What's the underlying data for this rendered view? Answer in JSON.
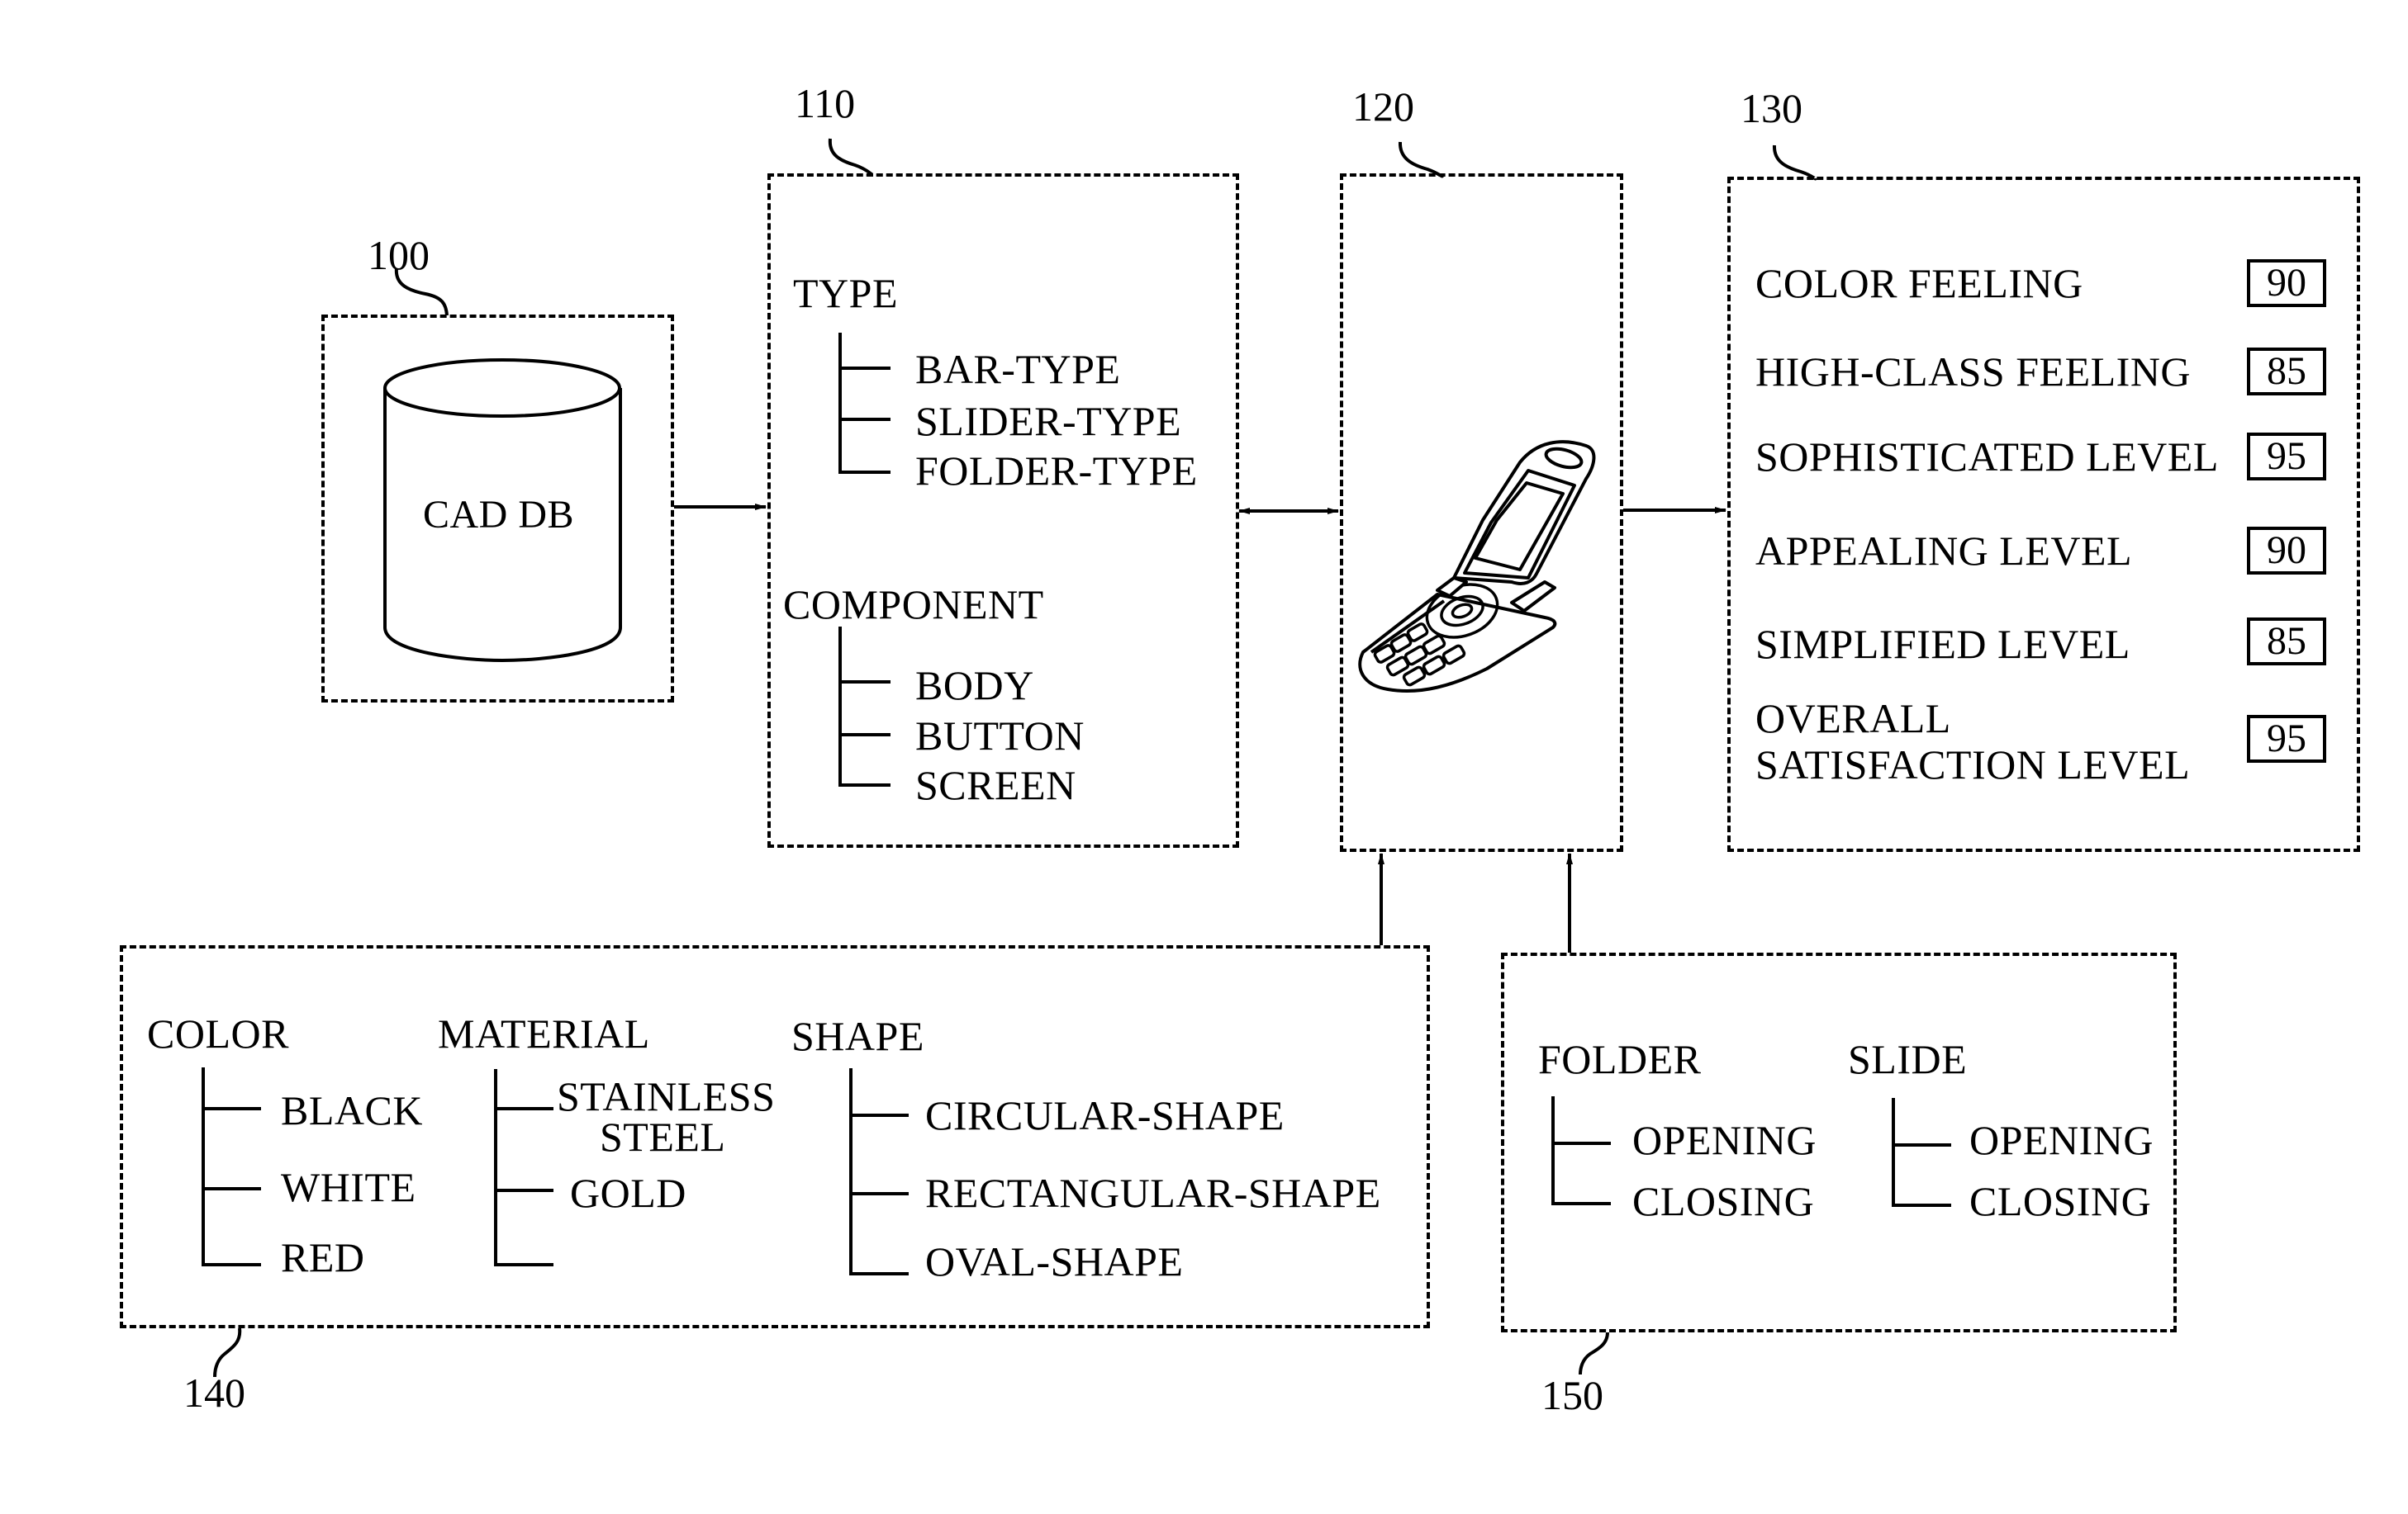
{
  "figure": {
    "cad_db": {
      "ref": "100",
      "label": "CAD DB"
    },
    "design_options": {
      "ref": "110",
      "groups": [
        {
          "title": "TYPE",
          "items": [
            "BAR-TYPE",
            "SLIDER-TYPE",
            "FOLDER-TYPE"
          ]
        },
        {
          "title": "COMPONENT",
          "items": [
            "BODY",
            "BUTTON",
            "SCREEN"
          ]
        }
      ]
    },
    "product_model": {
      "ref": "120",
      "icon": "flip-phone-icon"
    },
    "evaluation": {
      "ref": "130",
      "criteria": [
        {
          "label": "COLOR FEELING",
          "score": "90"
        },
        {
          "label": "HIGH-CLASS FEELING",
          "score": "85"
        },
        {
          "label": "SOPHISTICATED LEVEL",
          "score": "95"
        },
        {
          "label": "APPEALING LEVEL",
          "score": "90"
        },
        {
          "label": "SIMPLIFIED LEVEL",
          "score": "85"
        },
        {
          "label_line1": "OVERALL",
          "label_line2": "SATISFACTION LEVEL",
          "score": "95"
        }
      ]
    },
    "attributes": {
      "ref": "140",
      "groups": [
        {
          "title": "COLOR",
          "items": [
            "BLACK",
            "WHITE",
            "RED"
          ]
        },
        {
          "title": "MATERIAL",
          "items": [
            "STAINLESS STEEL",
            "GOLD",
            ""
          ],
          "item0_line1": "STAINLESS",
          "item0_line2": "STEEL"
        },
        {
          "title": "SHAPE",
          "items": [
            "CIRCULAR-SHAPE",
            "RECTANGULAR-SHAPE",
            "OVAL-SHAPE"
          ]
        }
      ]
    },
    "operations": {
      "ref": "150",
      "groups": [
        {
          "title": "FOLDER",
          "items": [
            "OPENING",
            "CLOSING"
          ]
        },
        {
          "title": "SLIDE",
          "items": [
            "OPENING",
            "CLOSING"
          ]
        }
      ]
    }
  }
}
